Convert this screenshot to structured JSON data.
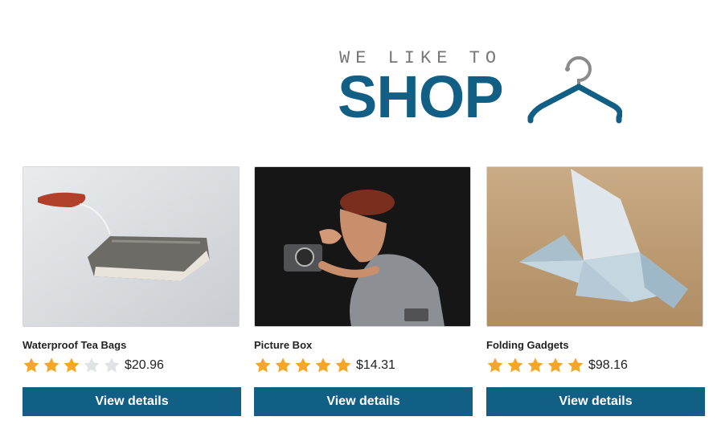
{
  "brand": {
    "tagline": "WE LIKE TO",
    "name": "SHOP",
    "logo_color": "#125f86",
    "icon": "hanger-icon"
  },
  "colors": {
    "accent": "#125f86",
    "star_filled": "#f5a623",
    "star_empty": "#dfe3e6"
  },
  "products": [
    {
      "name": "Waterproof Tea Bags",
      "rating": 3,
      "rating_max": 5,
      "price": "$20.96",
      "image": "tea-bag-photo",
      "button_label": "View details"
    },
    {
      "name": "Picture Box",
      "rating": 5,
      "rating_max": 5,
      "price": "$14.31",
      "image": "photographer-figurine-photo",
      "button_label": "View details"
    },
    {
      "name": "Folding Gadgets",
      "rating": 5,
      "rating_max": 5,
      "price": "$98.16",
      "image": "origami-banknote-photo",
      "button_label": "View details"
    }
  ]
}
